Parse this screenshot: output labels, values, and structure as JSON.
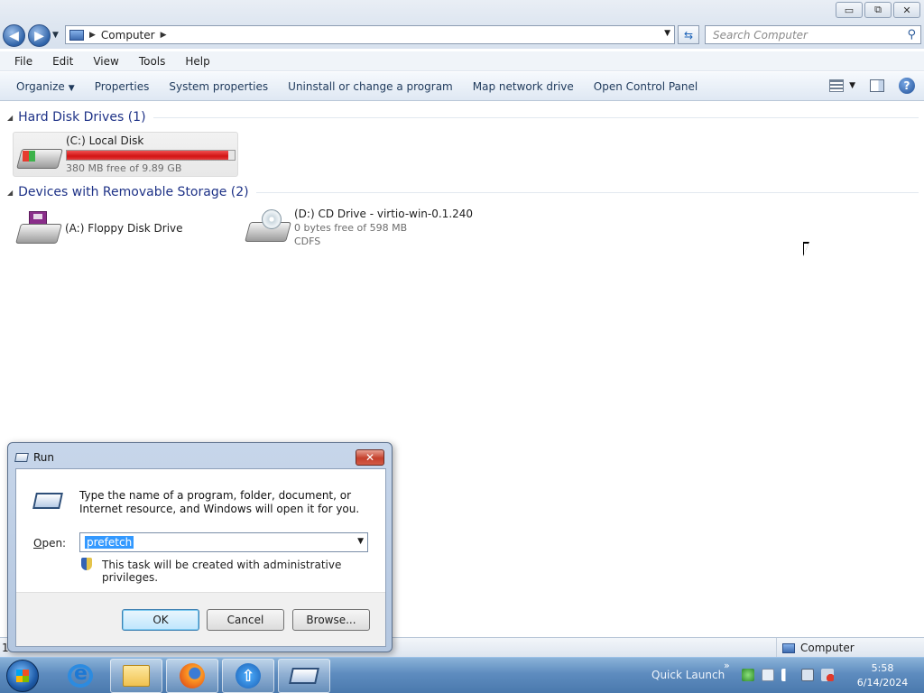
{
  "window": {
    "buttons": {
      "minimize": "▭",
      "restore": "⧉",
      "close": "✕"
    }
  },
  "address": {
    "crumb": "Computer",
    "search_placeholder": "Search Computer"
  },
  "menu": [
    "File",
    "Edit",
    "View",
    "Tools",
    "Help"
  ],
  "commands": {
    "organize": "Organize",
    "items": [
      "Properties",
      "System properties",
      "Uninstall or change a program",
      "Map network drive",
      "Open Control Panel"
    ]
  },
  "groups": {
    "hdd": {
      "title": "Hard Disk Drives (1)",
      "drive": {
        "name": "(C:) Local Disk",
        "free": "380 MB free of 9.89 GB",
        "used_fraction": 0.96,
        "bar_color": "#d21414"
      }
    },
    "removable": {
      "title": "Devices with Removable Storage (2)",
      "floppy": {
        "name": "(A:) Floppy Disk Drive"
      },
      "cd": {
        "name": "(D:) CD Drive - virtio-win-0.1.240",
        "free": "0 bytes free of 598 MB",
        "fs": "CDFS"
      }
    }
  },
  "status": {
    "left": "1",
    "location": "Computer"
  },
  "run_dialog": {
    "title": "Run",
    "description": "Type the name of a program, folder, document, or Internet resource, and Windows will open it for you.",
    "open_label_prefix": "O",
    "open_label_rest": "pen:",
    "value": "prefetch",
    "admin_note": "This task will be created with administrative privileges.",
    "ok": "OK",
    "cancel": "Cancel",
    "browse": "Browse..."
  },
  "taskbar": {
    "quick_launch": "Quick Launch",
    "time": "5:58",
    "date": "6/14/2024"
  }
}
